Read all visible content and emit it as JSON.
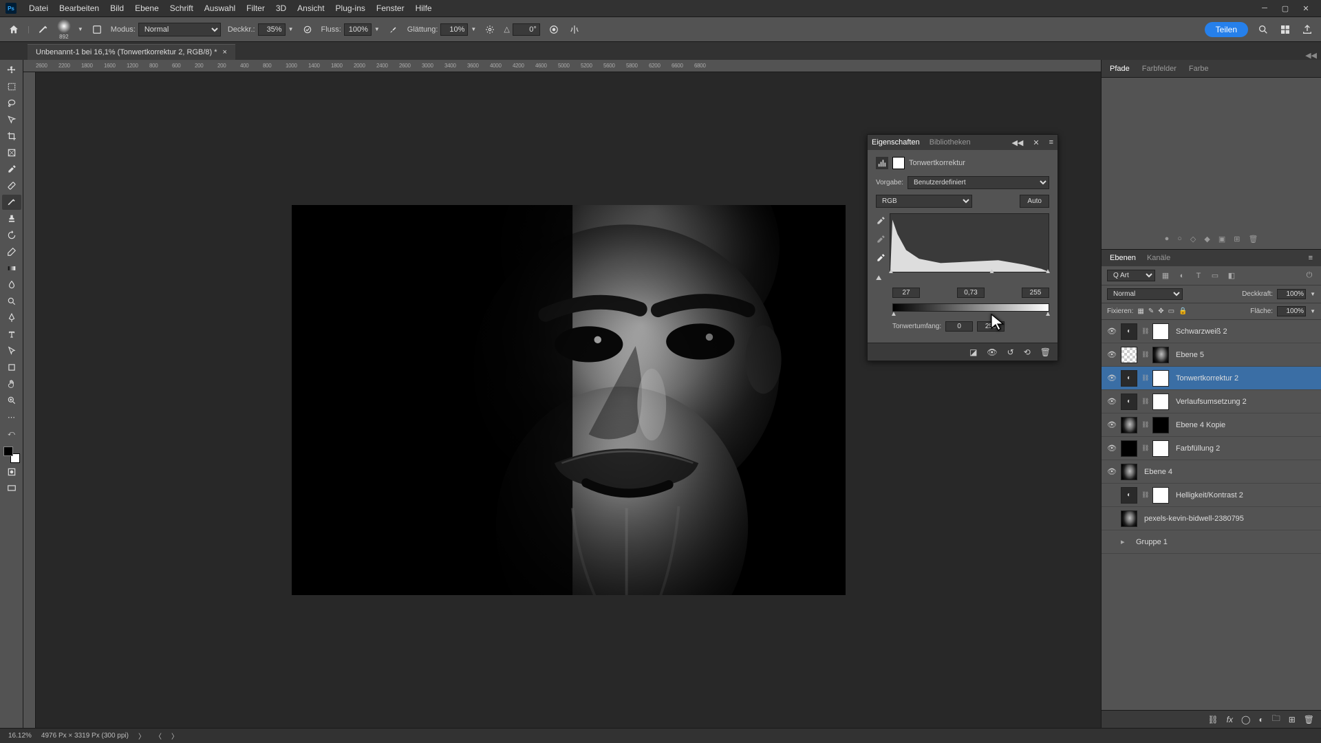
{
  "menubar": [
    "Datei",
    "Bearbeiten",
    "Bild",
    "Ebene",
    "Schrift",
    "Auswahl",
    "Filter",
    "3D",
    "Ansicht",
    "Plug-ins",
    "Fenster",
    "Hilfe"
  ],
  "optbar": {
    "brush_size": "892",
    "mode_label": "Modus:",
    "mode_value": "Normal",
    "opacity_label": "Deckkr.:",
    "opacity_value": "35%",
    "flow_label": "Fluss:",
    "flow_value": "100%",
    "smooth_label": "Glättung:",
    "smooth_value": "10%",
    "angle_icon": "△",
    "angle_value": "0°",
    "share_label": "Teilen"
  },
  "doc_tab": "Unbenannt-1 bei 16,1% (Tonwertkorrektur 2, RGB/8) *",
  "ruler_values": [
    "2600",
    "2200",
    "1800",
    "1600",
    "1200",
    "800",
    "600",
    "200",
    "200",
    "400",
    "800",
    "1000",
    "1400",
    "1800",
    "2000",
    "2400",
    "2600",
    "3000",
    "3400",
    "3600",
    "4000",
    "4200",
    "4600",
    "5000",
    "5200",
    "5600",
    "5800",
    "6200",
    "6600",
    "6800"
  ],
  "statusbar": {
    "zoom": "16.12%",
    "dims": "4976 Px × 3319 Px (300 ppi)"
  },
  "top_tabs": {
    "paths": "Pfade",
    "swatches": "Farbfelder",
    "color": "Farbe"
  },
  "collapsed_indicator": "◀◀",
  "props": {
    "tab_props": "Eigenschaften",
    "tab_libs": "Bibliotheken",
    "adj_name": "Tonwertkorrektur",
    "preset_label": "Vorgabe:",
    "preset_value": "Benutzerdefiniert",
    "channel_value": "RGB",
    "auto_label": "Auto",
    "input_black": "27",
    "input_gamma": "0,73",
    "input_white": "255",
    "output_label": "Tonwertumfang:",
    "output_black": "0",
    "output_white": "255"
  },
  "layers_panel": {
    "tab_layers": "Ebenen",
    "tab_channels": "Kanäle",
    "filter_kind": "Q Art",
    "blend_mode": "Normal",
    "opacity_label": "Deckkraft:",
    "opacity_value": "100%",
    "lock_label": "Fixieren:",
    "fill_label": "Fläche:",
    "fill_value": "100%"
  },
  "layers": [
    {
      "vis": "●",
      "expand": "",
      "name": "Schwarzweiß 2",
      "thumb": "adj",
      "mask": "mask",
      "link": "⛓"
    },
    {
      "vis": "●",
      "expand": "",
      "name": "Ebene 5",
      "thumb": "checker",
      "mask": "portrait",
      "link": "⛓"
    },
    {
      "vis": "●",
      "expand": "",
      "name": "Tonwertkorrektur 2",
      "thumb": "adj",
      "mask": "mask",
      "link": "⛓",
      "selected": true
    },
    {
      "vis": "●",
      "expand": "",
      "name": "Verlaufsumsetzung 2",
      "thumb": "adj",
      "mask": "mask",
      "link": "⛓"
    },
    {
      "vis": "●",
      "expand": "",
      "name": "Ebene 4 Kopie",
      "thumb": "portrait",
      "mask": "mask-dark",
      "link": "⛓"
    },
    {
      "vis": "●",
      "expand": "",
      "name": "Farbfüllung 2",
      "thumb": "mask-dark",
      "mask": "mask",
      "link": "⛓"
    },
    {
      "vis": "●",
      "expand": "",
      "name": "Ebene 4",
      "thumb": "portrait",
      "mask": "",
      "link": ""
    },
    {
      "vis": "",
      "expand": "",
      "name": "Helligkeit/Kontrast 2",
      "thumb": "adj",
      "mask": "mask",
      "link": "⛓"
    },
    {
      "vis": "",
      "expand": "",
      "name": "pexels-kevin-bidwell-2380795",
      "thumb": "portrait",
      "mask": "",
      "link": ""
    },
    {
      "vis": "",
      "expand": "▸",
      "name": "Gruppe 1",
      "thumb": "",
      "mask": "",
      "link": ""
    }
  ]
}
